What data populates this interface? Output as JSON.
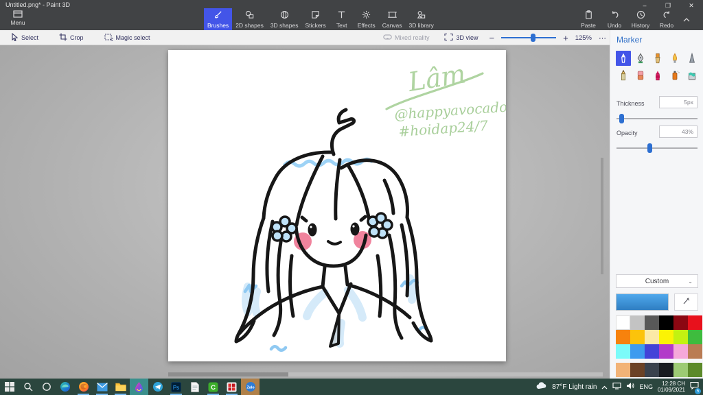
{
  "window": {
    "title": "Untitled.png* - Paint 3D",
    "controls": {
      "minimize": "–",
      "restore": "❐",
      "close": "✕"
    }
  },
  "ribbon": {
    "menu_label": "Menu",
    "tabs": [
      {
        "label": "Brushes",
        "active": true
      },
      {
        "label": "2D shapes",
        "active": false
      },
      {
        "label": "3D shapes",
        "active": false
      },
      {
        "label": "Stickers",
        "active": false
      },
      {
        "label": "Text",
        "active": false
      },
      {
        "label": "Effects",
        "active": false
      },
      {
        "label": "Canvas",
        "active": false
      },
      {
        "label": "3D library",
        "active": false
      }
    ],
    "actions": [
      {
        "label": "Paste"
      },
      {
        "label": "Undo"
      },
      {
        "label": "History"
      },
      {
        "label": "Redo"
      }
    ]
  },
  "toolbar": {
    "select": "Select",
    "crop": "Crop",
    "magic_select": "Magic select",
    "mixed_reality": "Mixed reality",
    "view_3d": "3D view",
    "zoom_minus": "−",
    "zoom_plus": "+",
    "zoom_percent": "125%",
    "more": "⋯"
  },
  "artwork": {
    "signature": "Lâm",
    "handle": "@happyavocado",
    "hashtag": "#hoidap24/7"
  },
  "panel": {
    "title": "Marker",
    "brushes": [
      "Marker",
      "Calligraphy pen",
      "Oil brush",
      "Watercolour",
      "Pixel pen",
      "Pencil",
      "Eraser",
      "Crayon",
      "Spray can",
      "Fill"
    ],
    "selected_brush": "Marker",
    "thickness_label": "Thickness",
    "thickness_value": "5px",
    "opacity_label": "Opacity",
    "opacity_value": "43%",
    "custom_label": "Custom",
    "current_color_top": "#4FA8EC",
    "current_color_bottom": "#2F7EC2",
    "palette_main": [
      [
        "#FFFFFF",
        "#C3C3C3",
        "#585858",
        "#000000",
        "#8B0712",
        "#E8111C"
      ],
      [
        "#F7820D",
        "#FCC30B",
        "#FBE9A6",
        "#FBF305",
        "#C3F211",
        "#3EBC3E"
      ],
      [
        "#7BFBF9",
        "#3E9BEF",
        "#4343D8",
        "#B23BC9",
        "#F5A8D9",
        "#BA7C54"
      ]
    ],
    "palette_extra": [
      "#F2B377",
      "#6B4226",
      "#3A424D",
      "#181B20",
      "#9DCB74",
      "#5C8A2A"
    ]
  },
  "taskbar": {
    "apps": [
      "start",
      "search",
      "cortana",
      "edge",
      "firefox",
      "mail",
      "file-explorer",
      "paint-3d",
      "telegram",
      "photoshop",
      "notepad",
      "clipchamp",
      "game",
      "zalo"
    ],
    "tray": {
      "weather": "87°F Light rain",
      "chevron": "^",
      "language": "ENG",
      "time": "12:28 CH",
      "date": "01/09/2021",
      "badge": "5"
    }
  },
  "colors": {
    "accent_blue": "#4355E8",
    "panel_title_blue": "#2E6EC6",
    "taskbar_bg": "#2B463E",
    "active_app_bg": "#3A8F8C",
    "slider_blue": "#2D6FD1"
  }
}
